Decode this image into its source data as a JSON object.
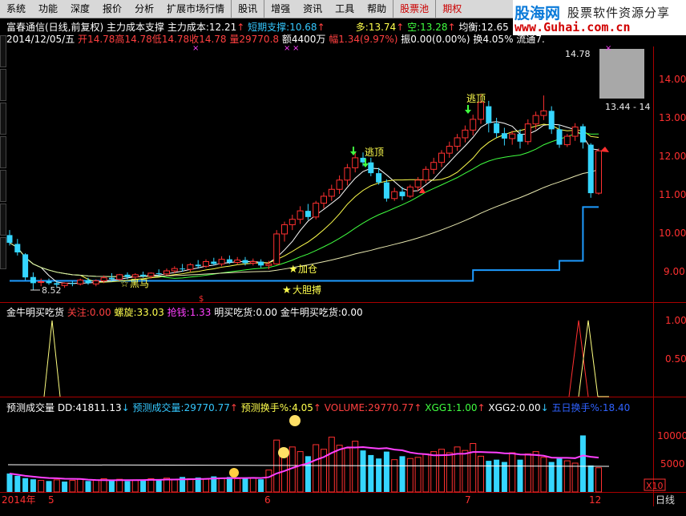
{
  "menu": [
    "系统",
    "功能",
    "深度",
    "报价",
    "分析",
    "扩展市场行情",
    "股讯",
    "增强",
    "资讯",
    "工具",
    "帮助",
    "股票池",
    "期权"
  ],
  "brand": {
    "logo": "股海网",
    "slogan": "股票软件资源分享",
    "url": "www.Guhai.com.cn"
  },
  "header1": {
    "stock": "富春通信(日线,前复权)",
    "indicator": "主力成本支撑",
    "cost_label": "主力成本:",
    "cost": "12.21",
    "support_label": "短期支撑:",
    "support": "10.68",
    "long_label": "多:",
    "long": "13.74",
    "short_label": "空:",
    "short": "13.28",
    "avg_label": "均衡:",
    "avg": "12.65"
  },
  "header2": {
    "date": "2014/12/05/五",
    "open_label": "开",
    "open": "14.78",
    "high_label": "高",
    "high": "14.78",
    "low_label": "低",
    "low": "14.78",
    "close_label": "收",
    "close": "14.78",
    "vol_label": "量",
    "vol": "29770.8",
    "amt_label": "额",
    "amt": "4400万",
    "chg_label": "幅",
    "chg": "1.34(9.97%)",
    "amp_label": "振",
    "amp": "0.00(0.00%)",
    "turn_label": "换",
    "turn": "4.05%",
    "float_label": "流通",
    "float": "7."
  },
  "main_chart": {
    "price_axis": [
      "14.00",
      "13.00",
      "12.00",
      "11.00",
      "10.00",
      "9.00"
    ],
    "annotations": {
      "top": "逃顶",
      "mid": "逃顶",
      "add": "加仓",
      "bold": "大胆搏",
      "dark_horse": "黑马",
      "low": "8.52",
      "high_box": "14.78",
      "range": "13.44 - 14"
    },
    "candles": [
      [
        9.95,
        10.08,
        9.68,
        9.75
      ],
      [
        9.72,
        9.85,
        9.42,
        9.5
      ],
      [
        9.45,
        9.48,
        8.78,
        8.85
      ],
      [
        8.86,
        8.98,
        8.52,
        8.7
      ],
      [
        8.72,
        8.82,
        8.62,
        8.74
      ],
      [
        8.75,
        8.82,
        8.66,
        8.7
      ],
      [
        8.7,
        8.78,
        8.6,
        8.66
      ],
      [
        8.64,
        8.72,
        8.58,
        8.7
      ],
      [
        8.7,
        8.76,
        8.62,
        8.68
      ],
      [
        8.68,
        8.82,
        8.64,
        8.78
      ],
      [
        8.78,
        8.84,
        8.66,
        8.7
      ],
      [
        8.68,
        8.8,
        8.62,
        8.76
      ],
      [
        8.76,
        8.9,
        8.7,
        8.84
      ],
      [
        8.84,
        8.96,
        8.74,
        8.8
      ],
      [
        8.8,
        8.94,
        8.76,
        8.92
      ],
      [
        8.92,
        8.98,
        8.8,
        8.86
      ],
      [
        8.86,
        8.96,
        8.78,
        8.92
      ],
      [
        8.92,
        9.0,
        8.84,
        8.88
      ],
      [
        8.88,
        8.98,
        8.82,
        8.96
      ],
      [
        8.96,
        9.06,
        8.88,
        8.94
      ],
      [
        8.94,
        9.08,
        8.9,
        9.02
      ],
      [
        9.02,
        9.14,
        8.96,
        9.08
      ],
      [
        9.08,
        9.2,
        9.0,
        9.06
      ],
      [
        9.06,
        9.22,
        9.0,
        9.18
      ],
      [
        9.18,
        9.3,
        9.08,
        9.14
      ],
      [
        9.14,
        9.32,
        9.1,
        9.26
      ],
      [
        9.26,
        9.36,
        9.16,
        9.2
      ],
      [
        9.2,
        9.4,
        9.14,
        9.32
      ],
      [
        9.32,
        9.42,
        9.2,
        9.24
      ],
      [
        9.24,
        9.38,
        9.18,
        9.3
      ],
      [
        9.3,
        9.38,
        9.16,
        9.22
      ],
      [
        9.22,
        9.34,
        9.16,
        9.26
      ],
      [
        9.26,
        9.32,
        9.1,
        9.16
      ],
      [
        9.16,
        9.28,
        9.06,
        9.2
      ],
      [
        9.2,
        10.08,
        9.18,
        9.98
      ],
      [
        9.98,
        10.3,
        9.78,
        10.22
      ],
      [
        10.22,
        10.48,
        10.08,
        10.36
      ],
      [
        10.36,
        10.7,
        10.24,
        10.58
      ],
      [
        10.58,
        10.76,
        10.34,
        10.42
      ],
      [
        10.42,
        10.84,
        10.36,
        10.78
      ],
      [
        10.78,
        11.06,
        10.64,
        10.96
      ],
      [
        10.96,
        11.26,
        10.84,
        11.14
      ],
      [
        11.14,
        11.5,
        11.02,
        11.38
      ],
      [
        11.38,
        11.8,
        11.24,
        11.7
      ],
      [
        11.7,
        12.12,
        11.58,
        11.96
      ],
      [
        11.96,
        12.1,
        11.74,
        11.84
      ],
      [
        11.84,
        11.96,
        11.48,
        11.56
      ],
      [
        11.56,
        11.7,
        11.26,
        11.32
      ],
      [
        11.32,
        11.4,
        10.82,
        10.9
      ],
      [
        10.9,
        11.18,
        10.84,
        11.08
      ],
      [
        11.08,
        11.2,
        10.86,
        10.96
      ],
      [
        10.96,
        11.26,
        10.92,
        11.2
      ],
      [
        11.2,
        11.46,
        11.1,
        11.38
      ],
      [
        11.38,
        11.74,
        11.3,
        11.66
      ],
      [
        11.66,
        11.96,
        11.54,
        11.84
      ],
      [
        11.84,
        12.16,
        11.72,
        12.08
      ],
      [
        12.08,
        12.38,
        11.96,
        12.26
      ],
      [
        12.26,
        12.58,
        12.14,
        12.48
      ],
      [
        12.48,
        12.8,
        12.36,
        12.68
      ],
      [
        12.68,
        13.08,
        12.54,
        12.96
      ],
      [
        12.96,
        13.6,
        12.84,
        13.4
      ],
      [
        13.3,
        13.44,
        12.62,
        12.86
      ],
      [
        12.86,
        13.0,
        12.48,
        12.6
      ],
      [
        12.6,
        12.74,
        12.28,
        12.46
      ],
      [
        12.46,
        12.66,
        12.3,
        12.58
      ],
      [
        12.58,
        12.7,
        12.2,
        12.38
      ],
      [
        12.38,
        12.96,
        12.3,
        12.84
      ],
      [
        12.84,
        13.16,
        12.7,
        13.06
      ],
      [
        13.06,
        13.58,
        12.94,
        13.18
      ],
      [
        13.18,
        13.3,
        12.58,
        12.7
      ],
      [
        12.7,
        12.82,
        12.22,
        12.3
      ],
      [
        12.3,
        12.58,
        12.24,
        12.52
      ],
      [
        12.52,
        12.86,
        12.4,
        12.76
      ],
      [
        12.78,
        12.84,
        12.2,
        12.36
      ],
      [
        12.3,
        12.34,
        10.92,
        11.04
      ],
      [
        11.04,
        12.2,
        11.0,
        12.14
      ]
    ],
    "cost_line": [
      8.76,
      8.76,
      8.76,
      8.76,
      8.76,
      8.76,
      8.76,
      8.76,
      8.76,
      8.76,
      8.76,
      8.76,
      8.76,
      8.76,
      8.76,
      8.76,
      8.76,
      8.76,
      8.76,
      8.76,
      8.76,
      8.76,
      8.76,
      8.76,
      8.76,
      8.76,
      8.76,
      8.76,
      8.76,
      8.76,
      8.76,
      8.76,
      8.76,
      8.76,
      8.76,
      8.76,
      8.76,
      8.76,
      8.76,
      8.76,
      8.76,
      8.76,
      8.76,
      8.76,
      8.76,
      8.76,
      8.76,
      8.76,
      8.76,
      8.76,
      8.76,
      8.76,
      8.76,
      8.76,
      8.76,
      8.76,
      8.76,
      8.76,
      8.76,
      9.04,
      9.04,
      9.04,
      9.04,
      9.04,
      9.04,
      9.04,
      9.04,
      9.04,
      9.04,
      9.04,
      9.28,
      9.28,
      9.28,
      10.68,
      10.68,
      10.68
    ]
  },
  "panel2": {
    "name": "金牛明买吃货",
    "f1_label": "关注:",
    "f1": "0.00",
    "f2_label": "螺旋:",
    "f2": "33.03",
    "f3_label": "抢钱:",
    "f3": "1.33",
    "f4_label": "明买吃货:",
    "f4": "0.00",
    "f5_label": "金牛明买吃货:",
    "f5": "0.00",
    "axis": [
      "1.00",
      "0.50"
    ]
  },
  "panel3": {
    "name": "预测成交量",
    "dd_label": "DD:",
    "dd": "41811.13",
    "pv_label": "预测成交量:",
    "pv": "29770.77",
    "pt_label": "预测换手%:",
    "pt": "4.05",
    "v_label": "VOLUME:",
    "v": "29770.77",
    "x1_label": "XGG1:",
    "x1": "1.00",
    "x2_label": "XGG2:",
    "x2": "0.00",
    "t5_label": "五日换手%:",
    "t5": "18.40",
    "axis": [
      "10000",
      "5000"
    ],
    "unit": "X10",
    "volumes": [
      3200,
      2800,
      2400,
      2200,
      2000,
      1900,
      2100,
      1800,
      2000,
      2200,
      1900,
      2100,
      2300,
      2000,
      2200,
      1900,
      2100,
      2000,
      2300,
      2200,
      2400,
      2100,
      2600,
      2300,
      2500,
      2200,
      2700,
      2400,
      2600,
      2300,
      2500,
      2400,
      2200,
      3800,
      9000,
      6500,
      7800,
      7000,
      6200,
      8200,
      7400,
      9500,
      8100,
      7600,
      8800,
      7200,
      6400,
      5800,
      7000,
      5600,
      6200,
      5800,
      6000,
      6600,
      7000,
      7400,
      6800,
      7800,
      7200,
      8400,
      6200,
      5400,
      5600,
      5200,
      6800,
      5600,
      6600,
      7000,
      6000,
      5200,
      5800,
      5400,
      5000,
      9800,
      4600,
      4200
    ],
    "vol_up": [
      false,
      false,
      false,
      false,
      true,
      false,
      true,
      false,
      true,
      true,
      false,
      true,
      true,
      false,
      true,
      false,
      true,
      false,
      true,
      false,
      true,
      true,
      false,
      true,
      false,
      true,
      false,
      true,
      false,
      true,
      false,
      true,
      false,
      true,
      true,
      true,
      true,
      true,
      false,
      true,
      true,
      true,
      true,
      true,
      true,
      false,
      false,
      false,
      false,
      true,
      false,
      true,
      true,
      true,
      true,
      true,
      true,
      true,
      true,
      true,
      true,
      false,
      false,
      false,
      true,
      false,
      true,
      true,
      true,
      false,
      false,
      true,
      true,
      false,
      false,
      true
    ]
  },
  "time_axis": {
    "year": "2014年",
    "m5": "5",
    "m6": "6",
    "m7": "7",
    "m12": "12",
    "period": "日线"
  },
  "colors": {
    "up": "#ff3030",
    "down": "#35d6ff",
    "cost": "#1e9bff",
    "ma5": "#ffffff",
    "ma10": "#ffff4d",
    "ma20": "#40ff40",
    "ma60": "#e8e8b0"
  }
}
